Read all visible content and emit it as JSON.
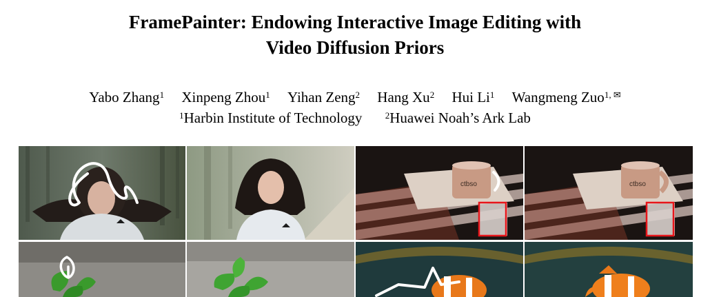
{
  "title_line1": "FramePainter: Endowing Interactive Image Editing with",
  "title_line2": "Video Diffusion Priors",
  "authors": [
    {
      "name": "Yabo Zhang",
      "sup": "1"
    },
    {
      "name": "Xinpeng Zhou",
      "sup": "1"
    },
    {
      "name": "Yihan Zeng",
      "sup": "2"
    },
    {
      "name": "Hang Xu",
      "sup": "2"
    },
    {
      "name": "Hui Li",
      "sup": "1"
    },
    {
      "name": "Wangmeng Zuo",
      "sup": "1, ✉"
    }
  ],
  "affiliations": [
    {
      "sup": "1",
      "name": "Harbin Institute of Technology"
    },
    {
      "sup": "2",
      "name": "Huawei Noah’s Ark Lab"
    }
  ],
  "figure": {
    "panels": [
      {
        "id": "girl-sketch",
        "sketch_color": "#ffffff"
      },
      {
        "id": "girl-result"
      },
      {
        "id": "mug-drag",
        "box_color": "#e8151a",
        "sketch_color": "#ffffff"
      },
      {
        "id": "mug-result",
        "box_color": "#e8151a"
      },
      {
        "id": "sprout-sketch",
        "sketch_color": "#ffffff"
      },
      {
        "id": "sprout-result"
      },
      {
        "id": "fish-sketch",
        "sketch_color": "#ffffff"
      },
      {
        "id": "fish-result"
      }
    ]
  }
}
